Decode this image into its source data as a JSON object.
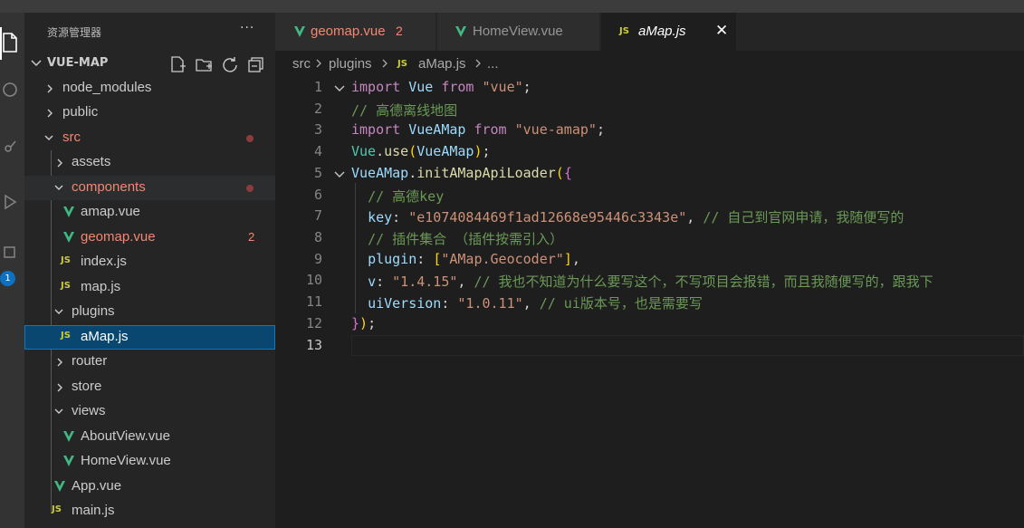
{
  "sidebar": {
    "title": "资源管理器",
    "more": "···",
    "project_name": "VUE-MAP",
    "tree": [
      {
        "label": "node_modules",
        "type": "folder",
        "expanded": false
      },
      {
        "label": "public",
        "type": "folder",
        "expanded": false
      },
      {
        "label": "src",
        "type": "folder",
        "expanded": true
      },
      {
        "label": "assets",
        "type": "folder",
        "expanded": false
      },
      {
        "label": "components",
        "type": "folder",
        "expanded": true
      },
      {
        "label": "amap.vue",
        "type": "vue"
      },
      {
        "label": "geomap.vue",
        "type": "vue",
        "errors": "2"
      },
      {
        "label": "index.js",
        "type": "js"
      },
      {
        "label": "map.js",
        "type": "js"
      },
      {
        "label": "plugins",
        "type": "folder",
        "expanded": true
      },
      {
        "label": "aMap.js",
        "type": "js",
        "selected": true
      },
      {
        "label": "router",
        "type": "folder",
        "expanded": false
      },
      {
        "label": "store",
        "type": "folder",
        "expanded": false
      },
      {
        "label": "views",
        "type": "folder",
        "expanded": true
      },
      {
        "label": "AboutView.vue",
        "type": "vue"
      },
      {
        "label": "HomeView.vue",
        "type": "vue"
      },
      {
        "label": "App.vue",
        "type": "vue"
      },
      {
        "label": "main.js",
        "type": "js"
      }
    ],
    "js_icon": "JS"
  },
  "activity": {
    "badge": "1",
    "icons": [
      "files-icon",
      "search-icon",
      "source-control-icon",
      "run-debug-icon",
      "extensions-icon"
    ]
  },
  "tabs": [
    {
      "label": "geomap.vue",
      "problems": "2",
      "icon": "vue-icon"
    },
    {
      "label": "HomeView.vue",
      "icon": "vue-icon"
    },
    {
      "label": "aMap.js",
      "icon": "js-icon",
      "active": true,
      "close": "✕"
    }
  ],
  "breadcrumb": {
    "parts": [
      "src",
      "plugins",
      "aMap.js",
      "..."
    ]
  },
  "editor": {
    "line_numbers": [
      "1",
      "2",
      "3",
      "4",
      "5",
      "6",
      "7",
      "8",
      "9",
      "10",
      "11",
      "12",
      "13"
    ],
    "lines": [
      {
        "t1": "import",
        "t2": "Vue",
        "t3": "from",
        "t4": "\"vue\"",
        "t5": ";"
      },
      {
        "c": "// 高德离线地图"
      },
      {
        "t1": "import",
        "t2": "VueAMap",
        "t3": "from",
        "t4": "\"vue-amap\"",
        "t5": ";"
      },
      {
        "a": "Vue",
        "b": ".",
        "c": "use",
        "d": "(",
        "e": "VueAMap",
        "f": ")",
        "g": ";"
      },
      {
        "a": "VueAMap",
        "b": ".",
        "c": "initAMapApiLoader",
        "d": "(",
        "e": "{"
      },
      {
        "c": "// 高德key"
      },
      {
        "k": "key",
        "s": "\"e1074084469f1ad12668e95446c3343e\"",
        "c": "// 自己到官网申请，我随便写的"
      },
      {
        "c": "// 插件集合 （插件按需引入）"
      },
      {
        "k": "plugin",
        "s": "\"AMap.Geocoder\""
      },
      {
        "k": "v",
        "s": "\"1.4.15\"",
        "c": "// 我也不知道为什么要写这个，不写项目会报错，而且我随便写的，跟我下"
      },
      {
        "k": "uiVersion",
        "s": "\"1.0.11\"",
        "c": "// ui版本号，也是需要写"
      },
      {
        "a": "}",
        "b": ")",
        "c": ";"
      },
      {}
    ]
  },
  "colors": {
    "accent": "#0e70c0",
    "modified": "#f48771",
    "selected_bg": "#094771"
  }
}
